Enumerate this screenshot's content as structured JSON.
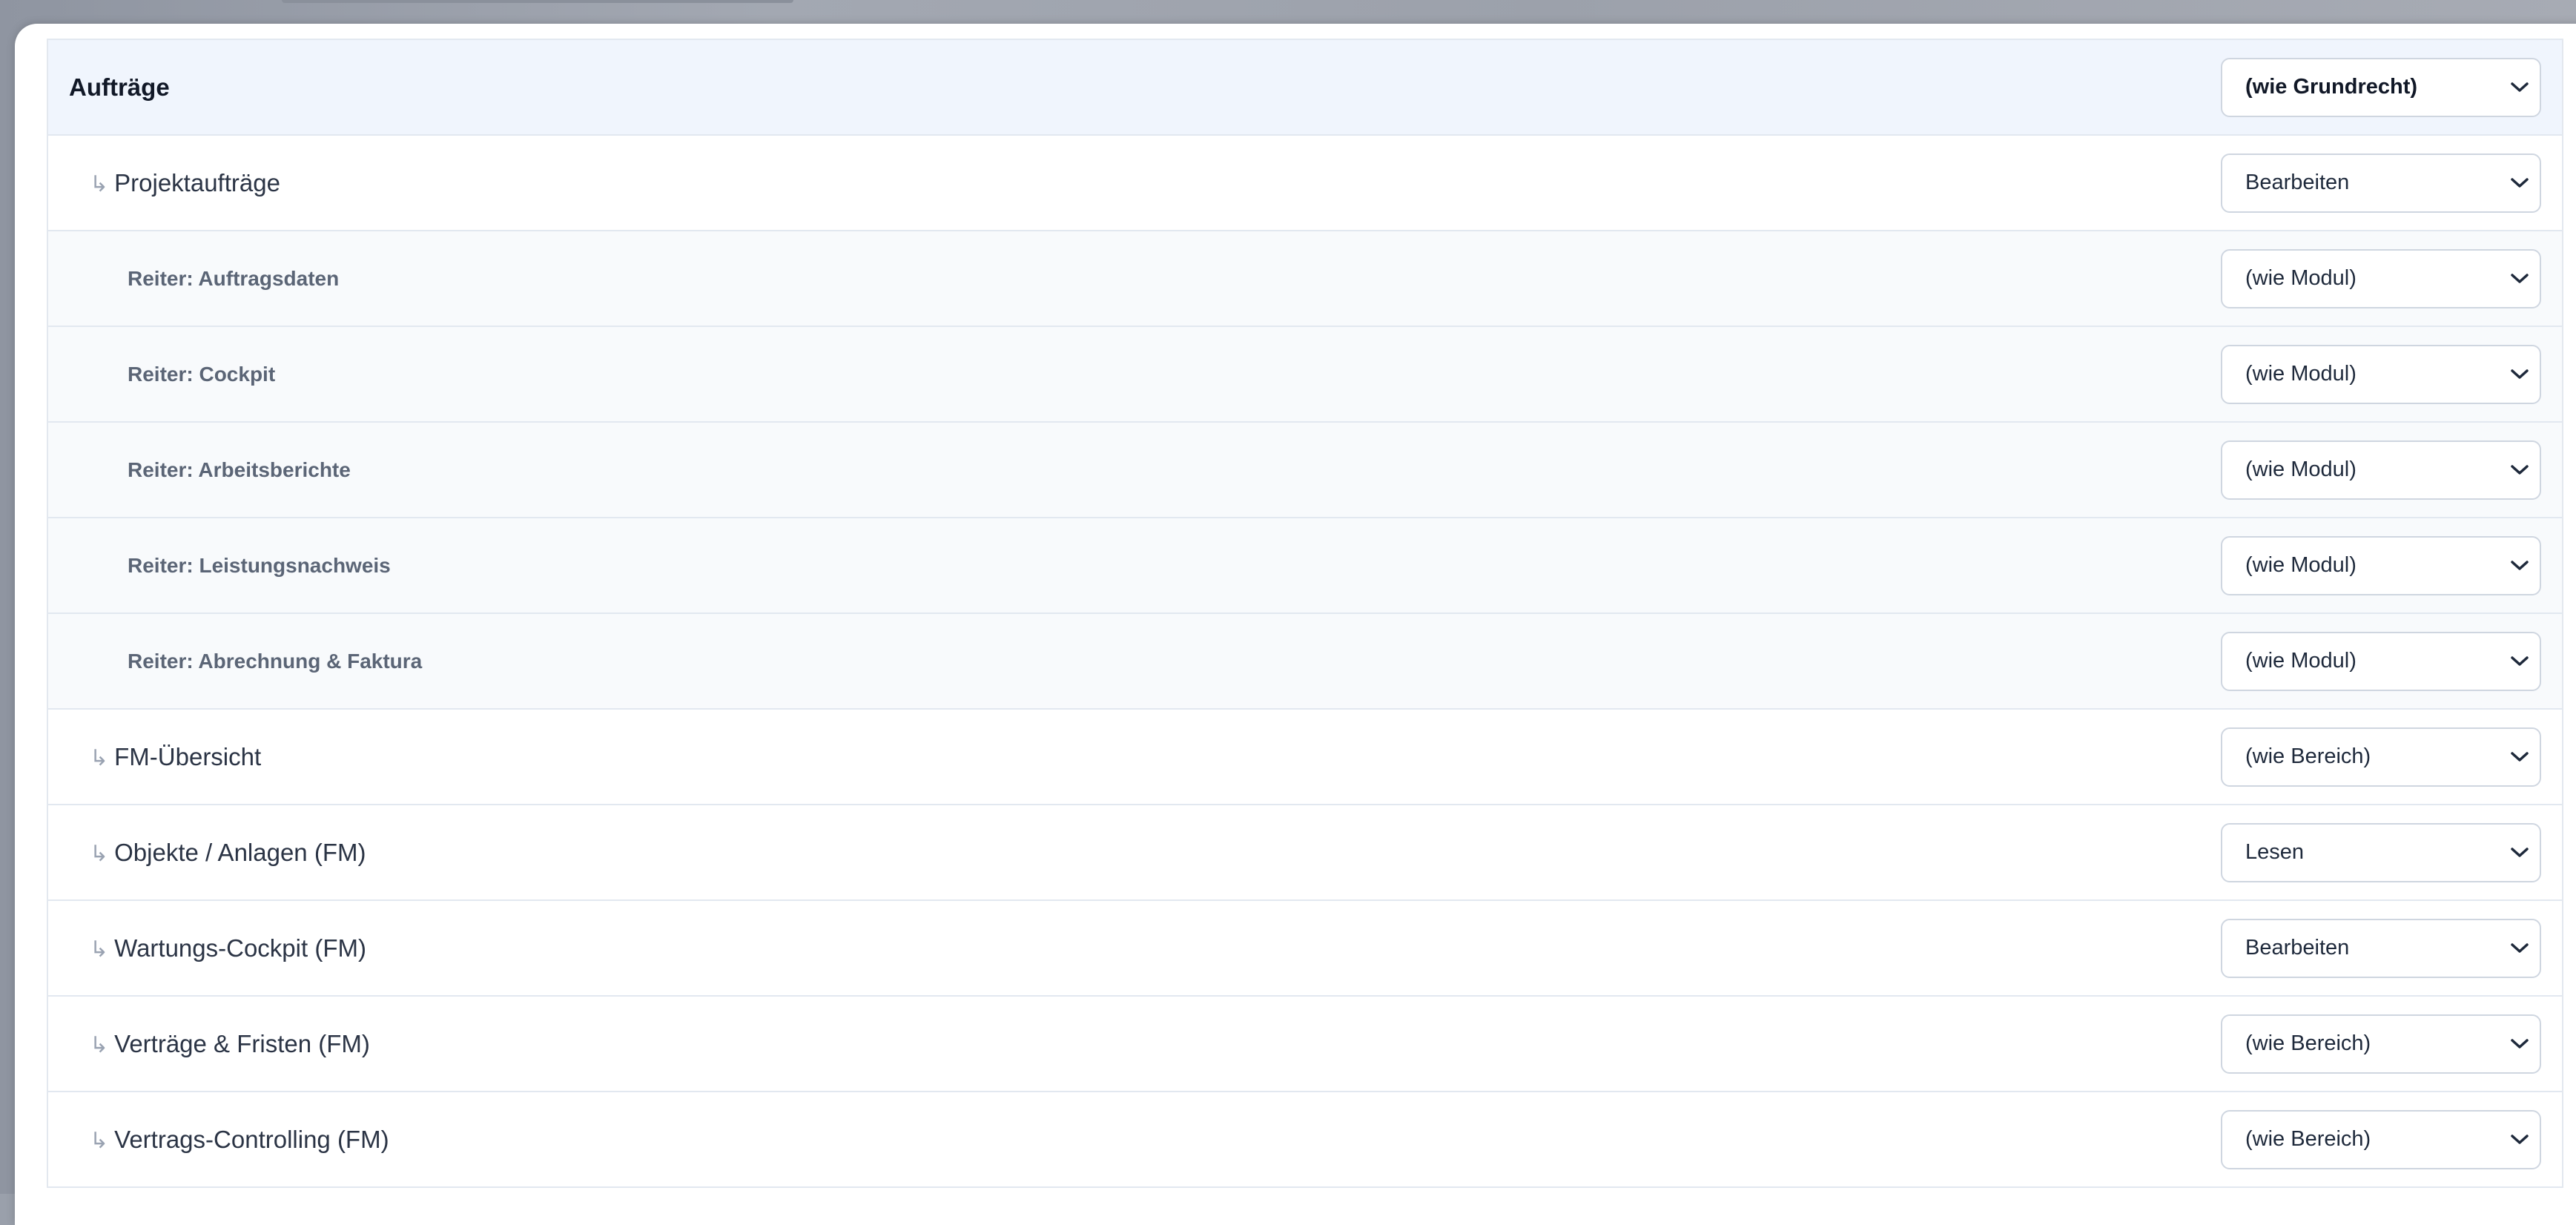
{
  "rows": [
    {
      "type": "group",
      "label": "Aufträge",
      "value": "(wie Grundrecht)"
    },
    {
      "type": "child",
      "label": "Projektaufträge",
      "value": "Bearbeiten"
    },
    {
      "type": "tab",
      "label": "Reiter: Auftragsdaten",
      "value": "(wie Modul)"
    },
    {
      "type": "tab",
      "label": "Reiter: Cockpit",
      "value": "(wie Modul)"
    },
    {
      "type": "tab",
      "label": "Reiter: Arbeitsberichte",
      "value": "(wie Modul)"
    },
    {
      "type": "tab",
      "label": "Reiter: Leistungsnachweis",
      "value": "(wie Modul)"
    },
    {
      "type": "tab",
      "label": "Reiter: Abrechnung & Faktura",
      "value": "(wie Modul)"
    },
    {
      "type": "child",
      "label": "FM-Übersicht",
      "value": "(wie Bereich)"
    },
    {
      "type": "child",
      "label": "Objekte / Anlagen (FM)",
      "value": "Lesen"
    },
    {
      "type": "child",
      "label": "Wartungs-Cockpit (FM)",
      "value": "Bearbeiten"
    },
    {
      "type": "child",
      "label": "Verträge & Fristen (FM)",
      "value": "(wie Bereich)"
    },
    {
      "type": "child",
      "label": "Vertrags-Controlling (FM)",
      "value": "(wie Bereich)"
    }
  ],
  "child_marker": "↳",
  "icons": {
    "dropdown": "chevron-down-icon"
  },
  "colors": {
    "group_row_bg": "#f0f5fd",
    "tab_row_bg": "#f8fafc",
    "border": "#e2e8f0",
    "backdrop": "#9aa0ab"
  }
}
